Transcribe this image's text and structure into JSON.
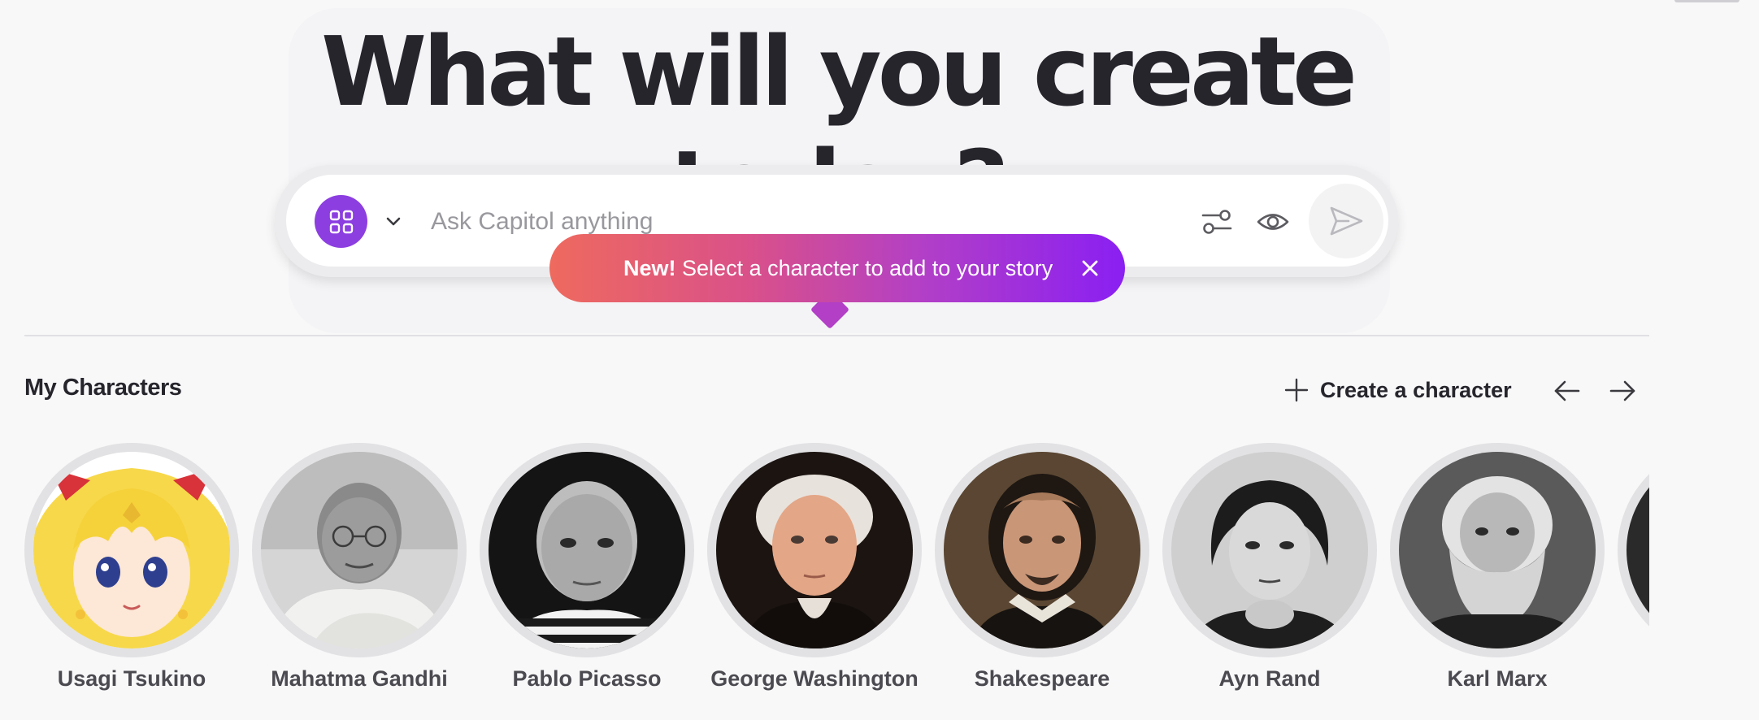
{
  "hero": {
    "title": "What will you create today?"
  },
  "composer": {
    "placeholder": "Ask Capitol anything",
    "icons": {
      "mode": "grid-icon",
      "chevron": "chevron-down-icon",
      "settings": "sliders-icon",
      "visibility": "eye-icon",
      "send": "send-icon"
    }
  },
  "tooltip": {
    "badge": "New!",
    "message": "Select a character to add to your story",
    "close_icon": "close-icon"
  },
  "characters_section": {
    "title": "My Characters",
    "create_label": "Create a character",
    "icons": {
      "create": "plus-icon",
      "prev": "arrow-left-icon",
      "next": "arrow-right-icon"
    }
  },
  "characters": [
    {
      "name": "Usagi Tsukino"
    },
    {
      "name": "Mahatma Gandhi"
    },
    {
      "name": "Pablo Picasso"
    },
    {
      "name": "George Washington"
    },
    {
      "name": "Shakespeare"
    },
    {
      "name": "Ayn Rand"
    },
    {
      "name": "Karl Marx"
    }
  ],
  "colors": {
    "accent_purple": "#8c3ee0",
    "tooltip_gradient_start": "#ee6a5e",
    "tooltip_gradient_end": "#8a1ff2",
    "background": "#f8f8f9",
    "text_dark": "#26252c"
  }
}
